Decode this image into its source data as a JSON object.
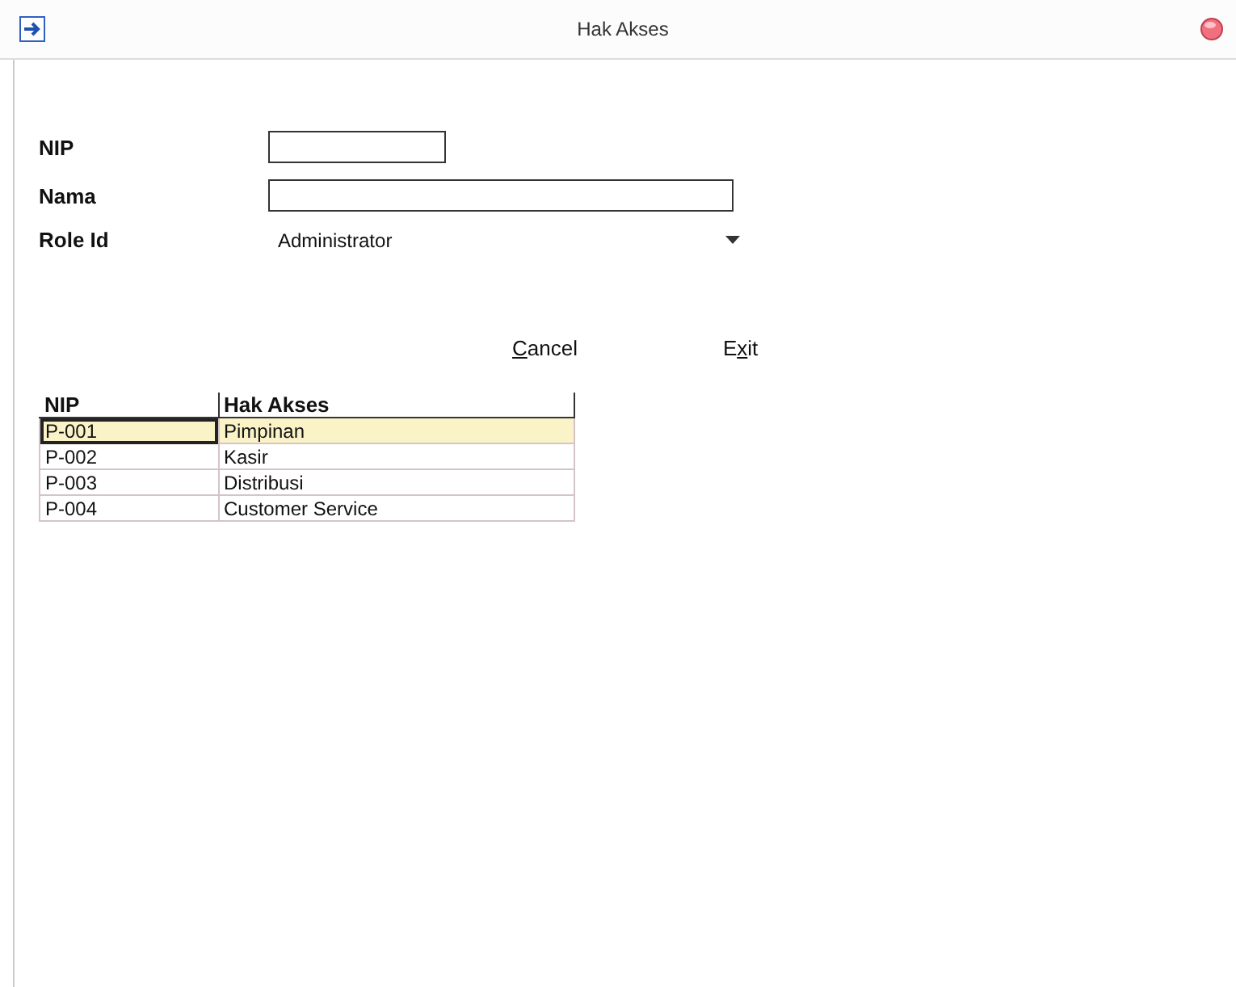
{
  "window": {
    "title": "Hak Akses"
  },
  "form": {
    "fields": [
      {
        "kind": "short_text",
        "label": "NIP"
      },
      {
        "kind": "long_text",
        "label": "Nama"
      },
      {
        "kind": "combo",
        "label": "Role Id",
        "value": "Administrator"
      }
    ]
  },
  "buttons": [
    {
      "mnemonic": "C",
      "after": "ancel"
    },
    {
      "before": "E",
      "mnemonic": "x",
      "after": "it"
    }
  ],
  "table": {
    "columns": [
      "NIP",
      "Hak Akses"
    ],
    "rows": [
      {
        "cells": [
          "P-001",
          "Pimpinan"
        ],
        "selected": true
      },
      {
        "cells": [
          "P-002",
          "Kasir"
        ],
        "selected": false
      },
      {
        "cells": [
          "P-003",
          "Distribusi"
        ],
        "selected": false
      },
      {
        "cells": [
          "P-004",
          "Customer Service"
        ],
        "selected": false
      }
    ]
  }
}
